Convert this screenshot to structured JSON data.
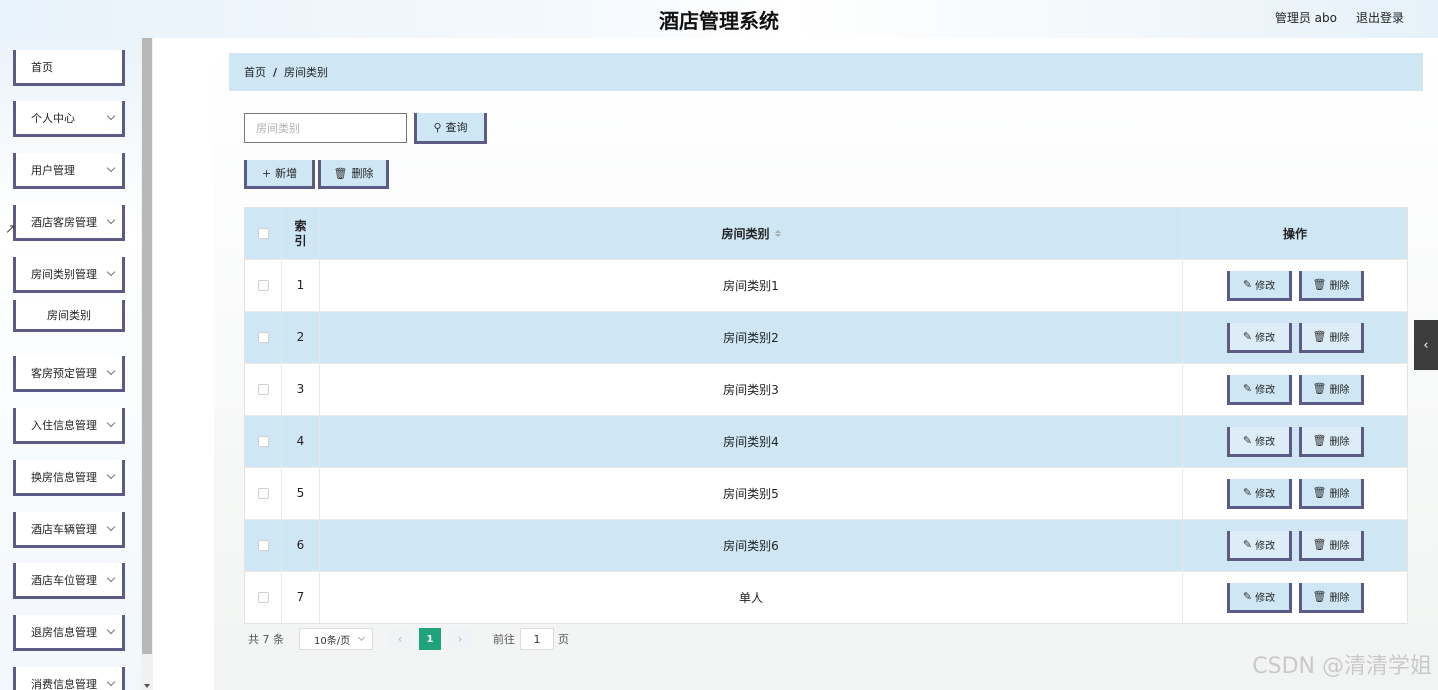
{
  "header": {
    "title": "酒店管理系统",
    "user": "管理员 abo",
    "logout": "退出登录"
  },
  "sidebar": {
    "items": [
      {
        "label": "首页",
        "chevron": false
      },
      {
        "label": "个人中心",
        "chevron": true
      },
      {
        "label": "用户管理",
        "chevron": true
      },
      {
        "label": "酒店客房管理",
        "chevron": true
      },
      {
        "label": "房间类别管理",
        "chevron": true
      },
      {
        "label": "客房预定管理",
        "chevron": true
      },
      {
        "label": "入住信息管理",
        "chevron": true
      },
      {
        "label": "换房信息管理",
        "chevron": true
      },
      {
        "label": "酒店车辆管理",
        "chevron": true
      },
      {
        "label": "酒店车位管理",
        "chevron": true
      },
      {
        "label": "退房信息管理",
        "chevron": true
      },
      {
        "label": "消费信息管理",
        "chevron": true
      }
    ],
    "sub_item": "房间类别"
  },
  "breadcrumb": {
    "home": "首页",
    "separator": "/",
    "current": "房间类别"
  },
  "search": {
    "placeholder": "房间类别",
    "button": "查询"
  },
  "toolbar": {
    "add": "新增",
    "delete": "删除"
  },
  "table": {
    "headers": {
      "index": "索引",
      "name": "房间类别",
      "ops": "操作"
    },
    "edit_label": "修改",
    "delete_label": "删除",
    "rows": [
      {
        "index": "1",
        "name": "房间类别1"
      },
      {
        "index": "2",
        "name": "房间类别2"
      },
      {
        "index": "3",
        "name": "房间类别3"
      },
      {
        "index": "4",
        "name": "房间类别4"
      },
      {
        "index": "5",
        "name": "房间类别5"
      },
      {
        "index": "6",
        "name": "房间类别6"
      },
      {
        "index": "7",
        "name": "单人"
      }
    ]
  },
  "pagination": {
    "total": "共 7 条",
    "page_size": "10条/页",
    "current_page": "1",
    "goto_label": "前往",
    "goto_value": "1",
    "page_unit": "页"
  },
  "watermark": "CSDN @清清学姐",
  "colors": {
    "accent": "#cfe7f4",
    "border": "#5b5b85",
    "active_page": "#1fa37b"
  },
  "icons": {
    "search": "search-icon",
    "add": "plus-icon",
    "delete": "trash-icon",
    "edit": "edit-icon",
    "collapse": "chevron-left-icon"
  }
}
